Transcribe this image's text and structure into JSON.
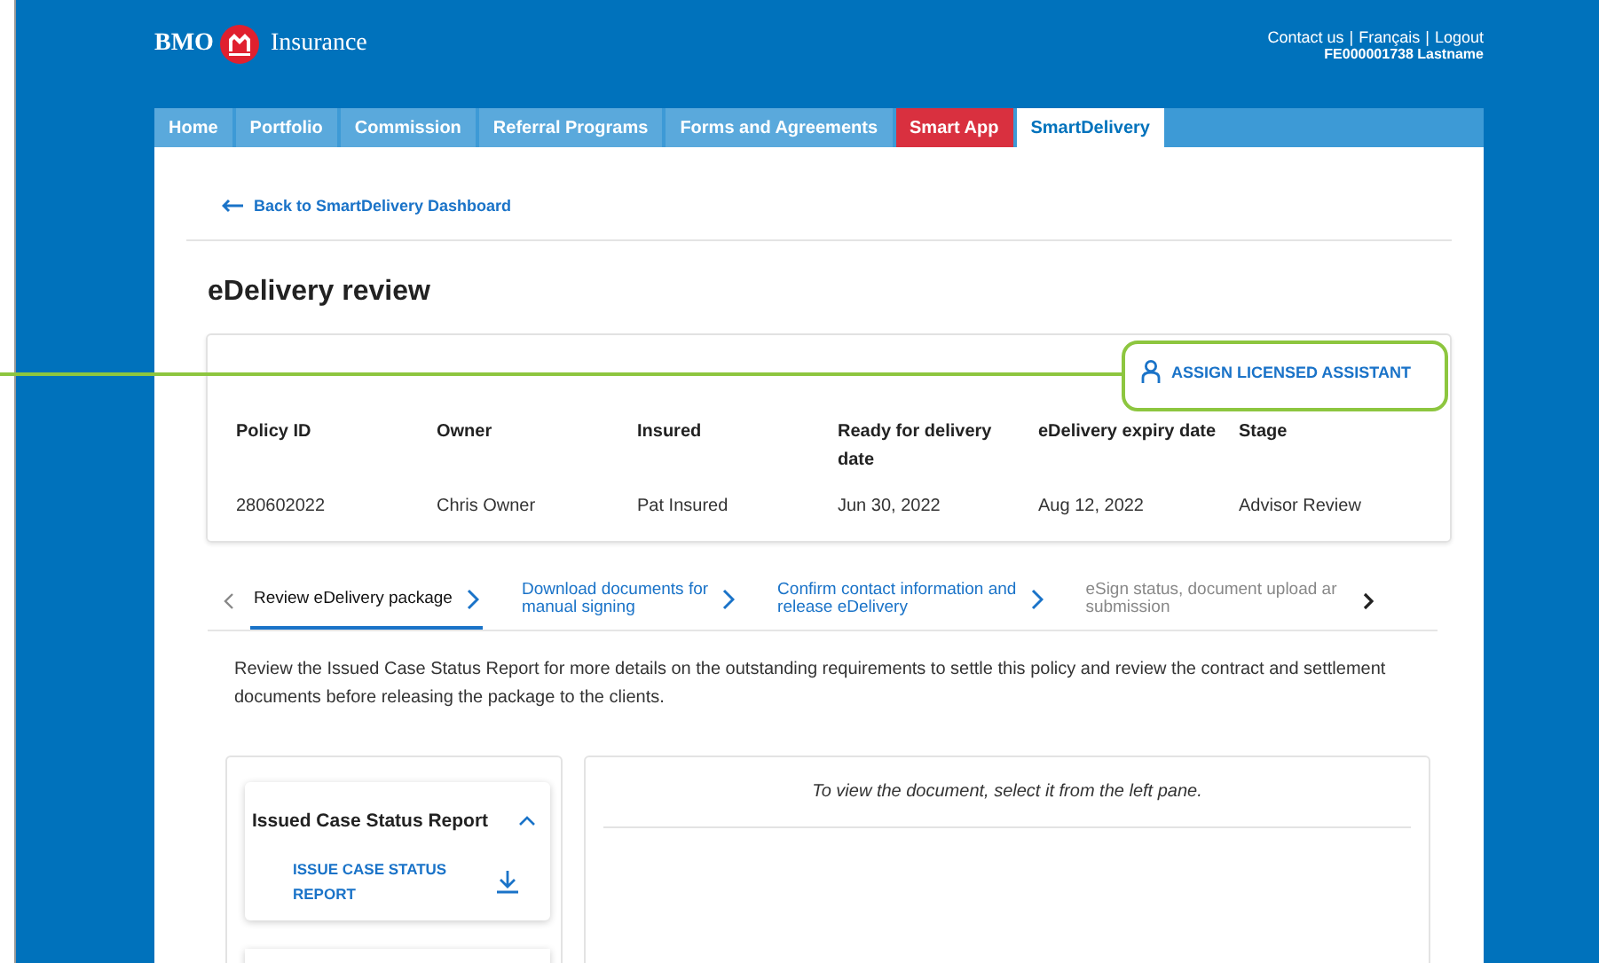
{
  "header": {
    "brand_left": "BMO",
    "brand_right": "Insurance",
    "links": [
      "Contact us",
      "Français",
      "Logout"
    ],
    "separator": "|",
    "account": "FE000001738 Lastname"
  },
  "nav": [
    {
      "label": "Home",
      "selected": false,
      "kind": "normal"
    },
    {
      "label": "Portfolio",
      "selected": false,
      "kind": "normal"
    },
    {
      "label": "Commission",
      "selected": false,
      "kind": "normal"
    },
    {
      "label": "Referral Programs",
      "selected": false,
      "kind": "normal"
    },
    {
      "label": "Forms and Agreements",
      "selected": false,
      "kind": "normal"
    },
    {
      "label": "Smart App",
      "selected": false,
      "kind": "highlight"
    },
    {
      "label": "SmartDelivery",
      "selected": true,
      "kind": "normal"
    }
  ],
  "back_link": "Back to SmartDelivery Dashboard",
  "page_title": "eDelivery review",
  "assign_button": "ASSIGN LICENSED ASSISTANT",
  "policy": {
    "columns": [
      "Policy ID",
      "Owner",
      "Insured",
      "Ready for delivery date",
      "eDelivery expiry date",
      "Stage"
    ],
    "values": [
      "280602022",
      "Chris Owner",
      "Pat Insured",
      "Jun 30, 2022",
      "Aug 12, 2022",
      "Advisor Review"
    ]
  },
  "steps": [
    {
      "lines": [
        "Review eDelivery package"
      ],
      "selected": true,
      "disabled": false
    },
    {
      "lines": [
        "Download documents for",
        "manual signing"
      ],
      "selected": false,
      "disabled": false
    },
    {
      "lines": [
        "Confirm contact information and",
        "release eDelivery"
      ],
      "selected": false,
      "disabled": false
    },
    {
      "lines": [
        "eSign status, document upload ar",
        "submission"
      ],
      "selected": false,
      "disabled": true
    }
  ],
  "description": "Review the Issued Case Status Report for more details on the outstanding requirements to settle this policy and review the contract and settlement documents before releasing the package to the clients.",
  "documents": [
    {
      "title": "Issued Case Status Report",
      "expanded": true,
      "items": [
        "ISSUE CASE STATUS REPORT"
      ]
    }
  ],
  "viewer_hint": "To view the document, select it from the left pane."
}
